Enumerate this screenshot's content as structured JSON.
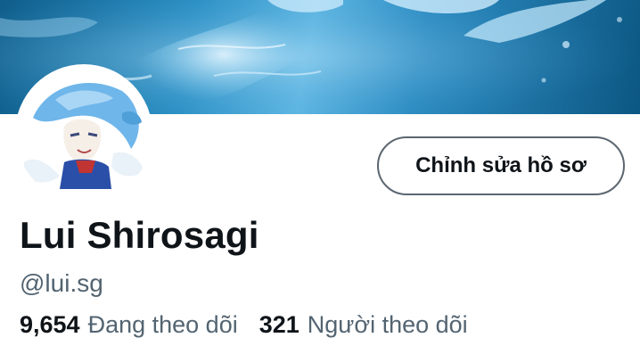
{
  "profile": {
    "display_name": "Lui Shirosagi",
    "handle": "@lui.sg",
    "edit_button_label": "Chỉnh sửa hồ sơ"
  },
  "stats": {
    "following_count": "9,654",
    "following_label": "Đang theo dõi",
    "followers_count": "321",
    "followers_label": "Người theo dõi"
  },
  "colors": {
    "text_primary": "#0f1419",
    "text_secondary": "#536471",
    "banner_blue": "#2a8fc4",
    "button_border": "#5b6670"
  }
}
